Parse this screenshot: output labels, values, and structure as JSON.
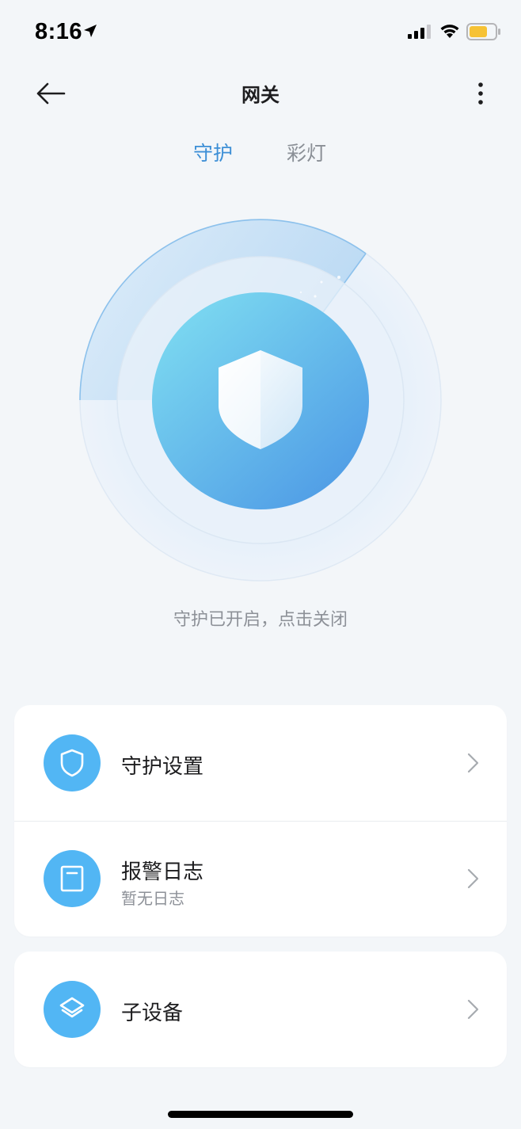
{
  "status_bar": {
    "time": "8:16"
  },
  "nav": {
    "title": "网关"
  },
  "tabs": [
    {
      "label": "守护",
      "active": true
    },
    {
      "label": "彩灯",
      "active": false
    }
  ],
  "guard": {
    "status_text": "守护已开启，点击关闭"
  },
  "menu": {
    "guard_settings": {
      "title": "守护设置",
      "icon": "shield-icon"
    },
    "alarm_log": {
      "title": "报警日志",
      "subtitle": "暂无日志",
      "icon": "log-icon"
    },
    "sub_devices": {
      "title": "子设备",
      "icon": "layers-icon"
    }
  },
  "colors": {
    "accent": "#3d8fd6",
    "icon_bg": "#52b6f4",
    "background": "#f3f6f9"
  }
}
